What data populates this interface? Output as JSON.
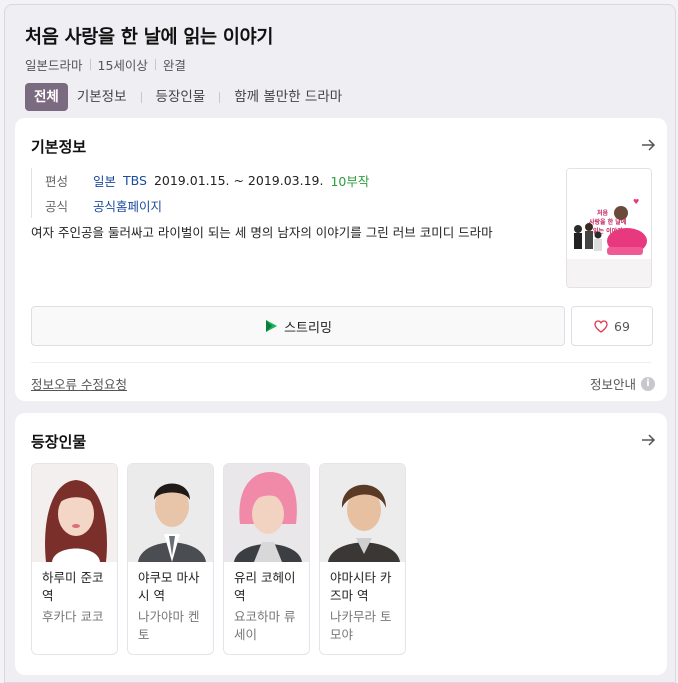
{
  "header": {
    "title": "처음 사랑을 한 날에 읽는 이야기",
    "meta": [
      "일본드라마",
      "15세이상",
      "완결"
    ],
    "tabs": [
      "전체",
      "기본정보",
      "등장인물",
      "함께 볼만한 드라마"
    ]
  },
  "basic": {
    "title": "기본정보",
    "broadcast_label": "편성",
    "country": "일본",
    "network": "TBS",
    "period": "2019.01.15. ~ 2019.03.19.",
    "episodes": "10부작",
    "official_label": "공식",
    "official_link": "공식홈페이지",
    "description": "여자 주인공을 둘러싸고 라이벌이 되는 세 명의 남자의 이야기를 그린 러브 코미디 드라마",
    "poster_text": "처음 사랑을 한 날에 읽는 이야기",
    "stream_label": "스트리밍",
    "like_count": "69",
    "report_label": "정보오류 수정요청",
    "guide_label": "정보안내",
    "guide_icon": "i"
  },
  "cast": {
    "title": "등장인물",
    "members": [
      {
        "role": "하루미 준코 역",
        "actor": "후카다 쿄코"
      },
      {
        "role": "야쿠모 마사시 역",
        "actor": "나가야마 켄토"
      },
      {
        "role": "유리 코헤이 역",
        "actor": "요코하마 류세이"
      },
      {
        "role": "야마시타 카즈마 역",
        "actor": "나카무라 토모야"
      }
    ]
  },
  "colors": {
    "accent": "#7b6b81",
    "link": "#1a4c9e",
    "green": "#2d9d3c",
    "heart": "#e0364c"
  }
}
